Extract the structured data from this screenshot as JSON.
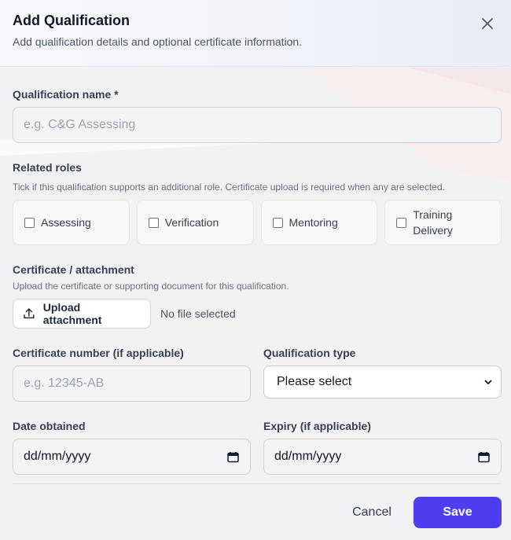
{
  "dialog": {
    "title": "Add Qualification",
    "subtitle": "Add qualification details and optional certificate information."
  },
  "qualification_name": {
    "label": "Qualification name *",
    "placeholder": "e.g. C&G Assessing"
  },
  "related_roles": {
    "label": "Related roles",
    "help": "Tick if this qualification supports an additional role. Certificate upload is required when any are selected.",
    "options": [
      {
        "label": "Assessing",
        "checked": false
      },
      {
        "label": "Verification",
        "checked": false
      },
      {
        "label": "Mentoring",
        "checked": false
      },
      {
        "label": "Training Delivery",
        "checked": false
      }
    ]
  },
  "certificate": {
    "label": "Certificate / attachment",
    "help": "Upload the certificate or supporting document for this qualification.",
    "upload_label": "Upload attachment",
    "file_status": "No file selected"
  },
  "certificate_number": {
    "label": "Certificate number (if applicable)",
    "placeholder": "e.g. 12345-AB"
  },
  "qualification_type": {
    "label": "Qualification type",
    "value": "Please select"
  },
  "date_obtained": {
    "label": "Date obtained",
    "value": "dd/mm/yyyy"
  },
  "expiry": {
    "label": "Expiry (if applicable)",
    "value": "dd/mm/yyyy"
  },
  "footer": {
    "cancel_label": "Cancel",
    "save_label": "Save"
  },
  "colors": {
    "primary": "#4f3ef0",
    "background": "#f2f2f5"
  }
}
